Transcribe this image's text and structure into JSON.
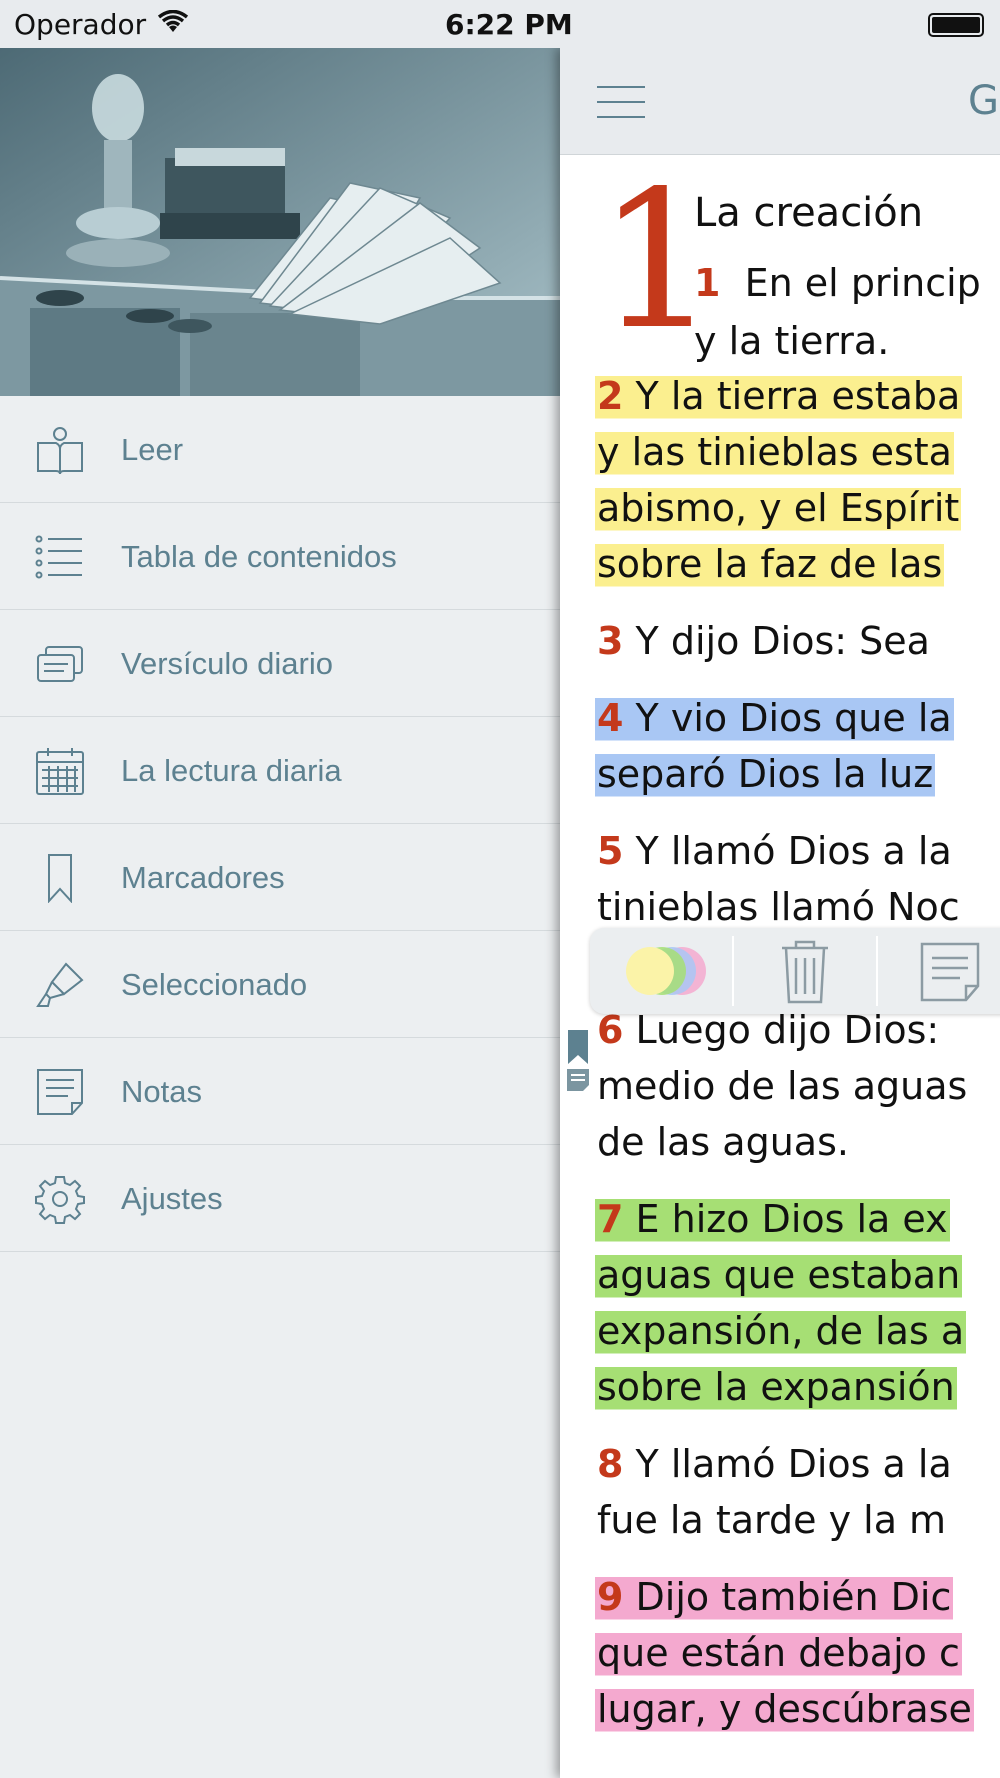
{
  "status_bar": {
    "carrier": "Operador",
    "time": "6:22 PM"
  },
  "menu": {
    "items": [
      {
        "label": "Leer",
        "icon": "open-book-icon"
      },
      {
        "label": "Tabla de contenidos",
        "icon": "list-icon"
      },
      {
        "label": "Versículo diario",
        "icon": "cards-icon"
      },
      {
        "label": "La lectura diaria",
        "icon": "calendar-icon"
      },
      {
        "label": "Marcadores",
        "icon": "bookmark-icon"
      },
      {
        "label": "Seleccionado",
        "icon": "highlighter-icon"
      },
      {
        "label": "Notas",
        "icon": "note-icon"
      },
      {
        "label": "Ajustes",
        "icon": "gear-icon"
      }
    ]
  },
  "reader": {
    "book_title_partial": "G",
    "chapter": "1",
    "section_title": "La creación",
    "verse1": {
      "num": "1",
      "lines": [
        "En el princip",
        "y la tierra."
      ]
    },
    "verses": [
      {
        "num": "2",
        "highlight": "yellow",
        "lines": [
          "Y la tierra estaba",
          "y las tinieblas esta",
          "abismo, y el Espírit",
          "sobre la faz de las"
        ]
      },
      {
        "num": "3",
        "highlight": "",
        "lines": [
          "Y dijo Dios: Sea"
        ]
      },
      {
        "num": "4",
        "highlight": "blue",
        "lines": [
          "Y vio Dios que la",
          "separó Dios la luz"
        ]
      },
      {
        "num": "5",
        "highlight": "",
        "lines": [
          "Y llamó Dios a la",
          "tinieblas llamó Noc"
        ]
      },
      {
        "num": "6",
        "highlight": "",
        "lines": [
          "Luego dijo Dios:",
          "medio de las aguas",
          "de las aguas."
        ]
      },
      {
        "num": "7",
        "highlight": "green",
        "lines": [
          "E hizo Dios la ex",
          "aguas que estaban",
          "expansión, de las a",
          "sobre la expansión"
        ]
      },
      {
        "num": "8",
        "highlight": "",
        "lines": [
          "Y llamó Dios a la",
          "fue la tarde y la m"
        ]
      },
      {
        "num": "9",
        "highlight": "pink",
        "lines": [
          "Dijo también Dic",
          "que están debajo c",
          "lugar, y descúbrase"
        ]
      }
    ],
    "toolbar": {
      "color_icon": "color-circles-icon",
      "delete_icon": "trash-icon",
      "note_icon": "note-icon"
    },
    "highlight_colors": {
      "yellow": "#fbef8f",
      "blue": "#a9c7f4",
      "green": "#a6df74",
      "pink": "#f4a9cf"
    },
    "accent_color": "#c4391b"
  }
}
